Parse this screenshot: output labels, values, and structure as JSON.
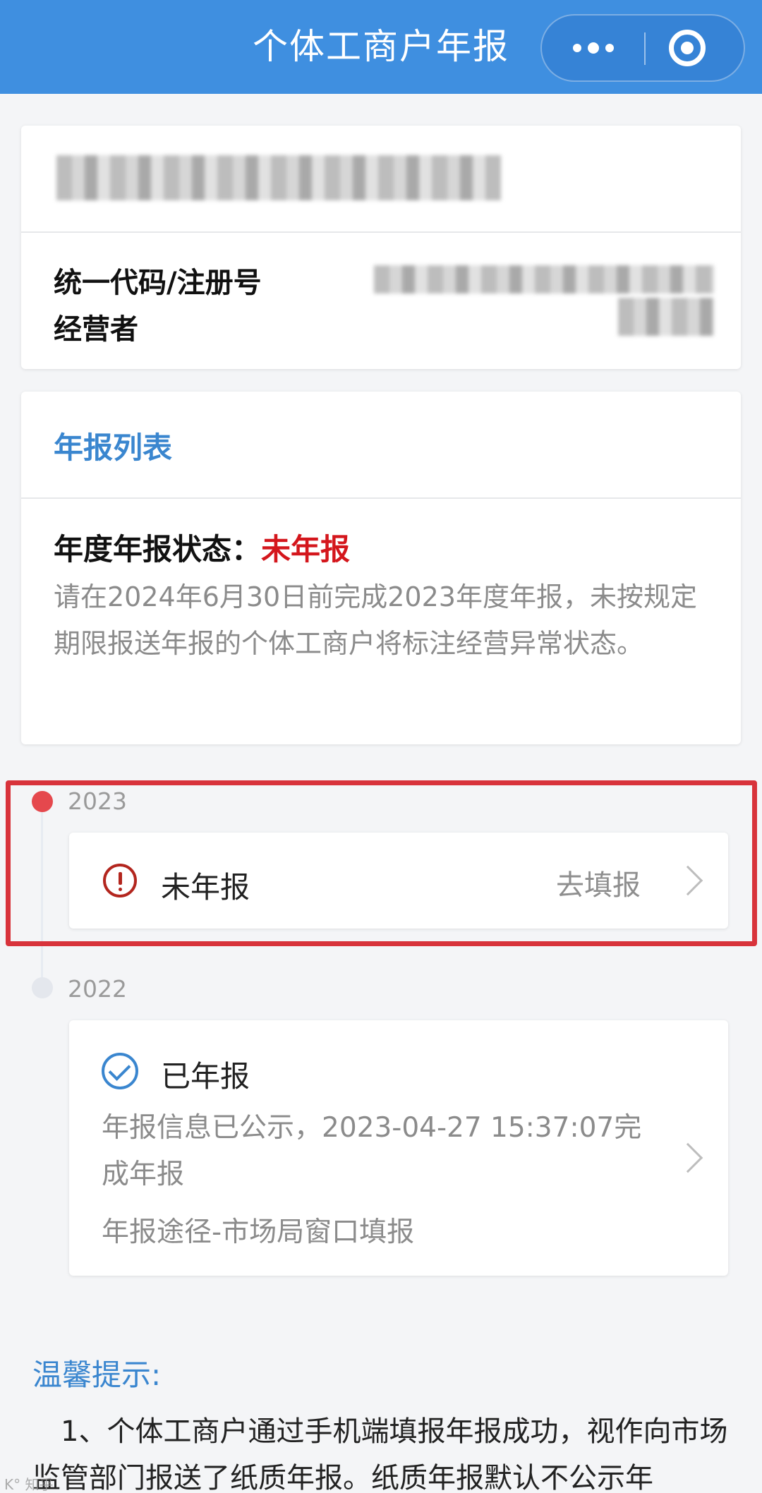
{
  "header": {
    "title": "个体工商户年报"
  },
  "info_card": {
    "code_label": "统一代码/注册号",
    "operator_label": "经营者"
  },
  "report_list": {
    "title": "年报列表",
    "status_label": "年度年报状态：",
    "status_value": "未年报",
    "description": "请在2024年6月30日前完成2023年度年报，未按规定期限报送年报的个体工商户将标注经营异常状态。"
  },
  "timeline": [
    {
      "year": "2023",
      "status": "未年报",
      "action": "去填报"
    },
    {
      "year": "2022",
      "status": "已年报",
      "info": "年报信息已公示，2023-04-27 15:37:07完成年报",
      "channel": "年报途径-市场局窗口填报"
    }
  ],
  "tips": {
    "title": "温馨提示:",
    "text": "1、个体工商户通过手机端填报年报成功，视作向市场监管部门报送了纸质年报。纸质年报默认不公示年"
  },
  "colors": {
    "header": "#3f8fe0",
    "accent": "#3a86cf",
    "alert": "#d4161c",
    "highlight_box": "#d8333b"
  },
  "icons": [
    "more-dots-icon",
    "target-icon",
    "warning-icon",
    "check-circle-icon",
    "chevron-right-icon"
  ]
}
